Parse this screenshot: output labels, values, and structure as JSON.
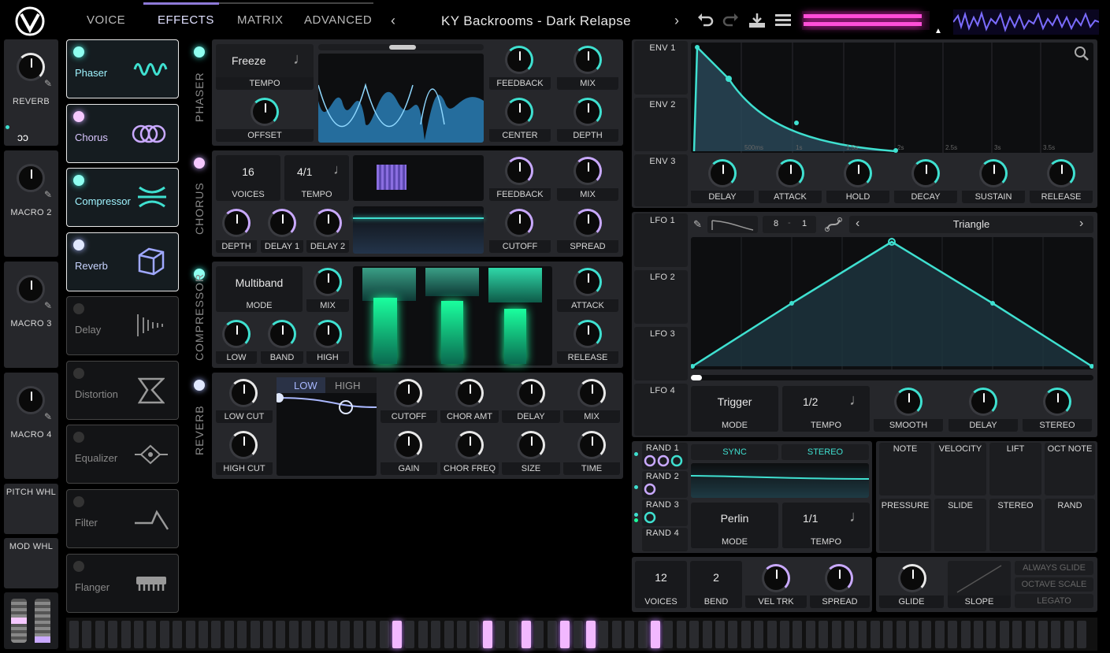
{
  "header": {
    "tabs": [
      "VOICE",
      "EFFECTS",
      "MATRIX",
      "ADVANCED"
    ],
    "preset_name": "KY Backrooms - Dark Relapse"
  },
  "left_sidebar": {
    "items": [
      "REVERB",
      "MACRO 2",
      "MACRO 3",
      "MACRO 4",
      "PITCH WHL",
      "MOD WHL"
    ]
  },
  "effects_list": [
    {
      "name": "Phaser",
      "icon": "phaser-icon",
      "enabled": true
    },
    {
      "name": "Chorus",
      "icon": "chorus-icon",
      "enabled": true
    },
    {
      "name": "Compressor",
      "icon": "compressor-icon",
      "enabled": true
    },
    {
      "name": "Reverb",
      "icon": "reverb-icon",
      "enabled": true
    },
    {
      "name": "Delay",
      "icon": "delay-icon",
      "enabled": false
    },
    {
      "name": "Distortion",
      "icon": "distortion-icon",
      "enabled": false
    },
    {
      "name": "Equalizer",
      "icon": "equalizer-icon",
      "enabled": false
    },
    {
      "name": "Filter",
      "icon": "filter-icon",
      "enabled": false
    },
    {
      "name": "Flanger",
      "icon": "flanger-icon",
      "enabled": false
    }
  ],
  "phaser": {
    "title": "PHASER",
    "sync_mode": "Freeze",
    "labels": {
      "tempo": "TEMPO",
      "offset": "OFFSET",
      "feedback": "FEEDBACK",
      "mix": "MIX",
      "center": "CENTER",
      "depth": "DEPTH"
    }
  },
  "chorus": {
    "title": "CHORUS",
    "voices_value": "16",
    "tempo_value": "4/1",
    "labels": {
      "voices": "VOICES",
      "tempo": "TEMPO",
      "feedback": "FEEDBACK",
      "mix": "MIX",
      "depth": "DEPTH",
      "delay1": "DELAY 1",
      "delay2": "DELAY 2",
      "cutoff": "CUTOFF",
      "spread": "SPREAD"
    }
  },
  "compressor": {
    "title": "COMPRESSOR",
    "mode_value": "Multiband",
    "labels": {
      "mode": "MODE",
      "mix": "MIX",
      "low": "LOW",
      "band": "BAND",
      "high": "HIGH",
      "attack": "ATTACK",
      "release": "RELEASE"
    }
  },
  "reverb": {
    "title": "REVERB",
    "tab_low": "LOW",
    "tab_high": "HIGH",
    "labels": {
      "low_cut": "LOW CUT",
      "high_cut": "HIGH CUT",
      "cutoff": "CUTOFF",
      "chor_amt": "CHOR AMT",
      "delay": "DELAY",
      "mix": "MIX",
      "gain": "GAIN",
      "chor_freq": "CHOR FREQ",
      "size": "SIZE",
      "time": "TIME"
    }
  },
  "envelopes": {
    "slots": [
      "ENV 1",
      "ENV 2",
      "ENV 3"
    ],
    "time_ticks": [
      "500ms",
      "1s",
      "1.5s",
      "2s",
      "2.5s",
      "3s",
      "3.5s"
    ],
    "labels": [
      "DELAY",
      "ATTACK",
      "HOLD",
      "DECAY",
      "SUSTAIN",
      "RELEASE"
    ]
  },
  "lfos": {
    "slots": [
      "LFO 1",
      "LFO 2",
      "LFO 3",
      "LFO 4"
    ],
    "grid_x": "8",
    "grid_y": "1",
    "shape": "Triangle",
    "mode_value": "Trigger",
    "tempo_value": "1/2",
    "labels": {
      "mode": "MODE",
      "tempo": "TEMPO",
      "smooth": "SMOOTH",
      "delay": "DELAY",
      "stereo": "STEREO"
    }
  },
  "randoms": {
    "slots": [
      "RAND 1",
      "RAND 2",
      "RAND 3",
      "RAND 4"
    ],
    "sync": "SYNC",
    "stereo": "STEREO",
    "style_value": "Perlin",
    "tempo_value": "1/1",
    "labels": {
      "mode": "MODE",
      "tempo": "TEMPO"
    }
  },
  "mod_sources": [
    "NOTE",
    "VELOCITY",
    "LIFT",
    "OCT NOTE",
    "PRESSURE",
    "SLIDE",
    "STEREO",
    "RAND"
  ],
  "voice": {
    "voices_value": "12",
    "bend_value": "2",
    "labels": {
      "voices": "VOICES",
      "bend": "BEND",
      "vel_trk": "VEL TRK",
      "spread": "SPREAD",
      "glide": "GLIDE",
      "slope": "SLOPE"
    }
  },
  "glide_options": [
    "ALWAYS GLIDE",
    "OCTAVE SCALE",
    "LEGATO"
  ],
  "colors": {
    "accent_teal": "#3fe0d0",
    "accent_purple": "#c9a9ff",
    "background": "#000000",
    "panel": "#26272b"
  }
}
